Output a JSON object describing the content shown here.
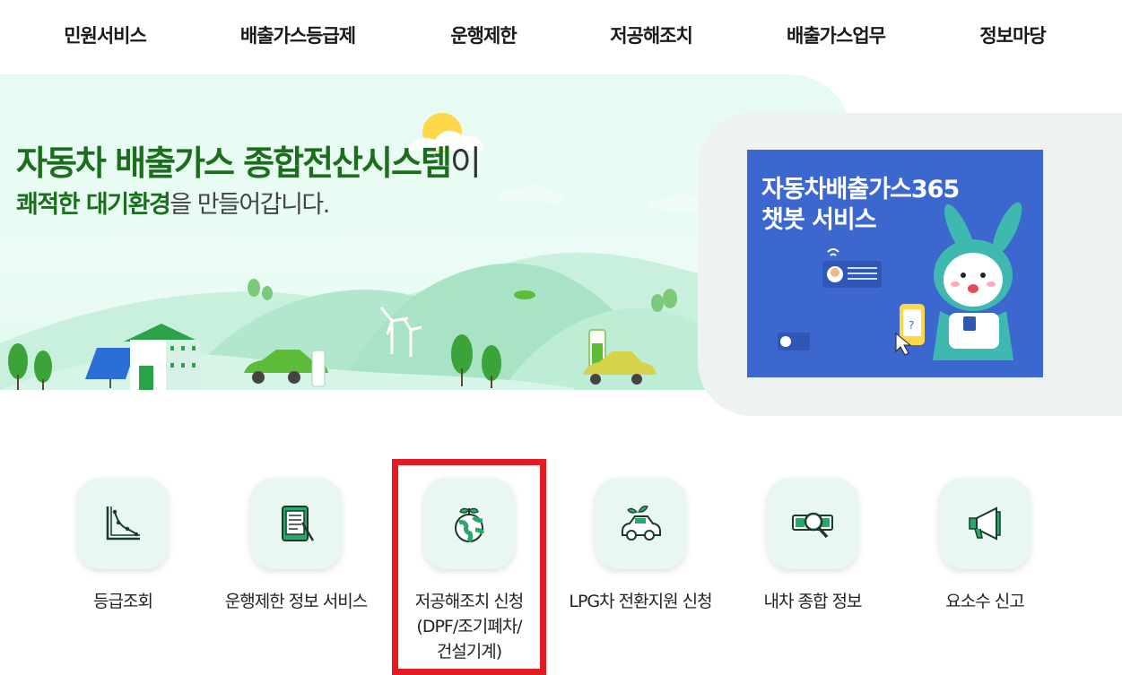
{
  "nav": {
    "items": [
      {
        "label": "민원서비스"
      },
      {
        "label": "배출가스등급제"
      },
      {
        "label": "운행제한"
      },
      {
        "label": "저공해조치"
      },
      {
        "label": "배출가스업무"
      },
      {
        "label": "정보마당"
      }
    ]
  },
  "hero": {
    "title_strong": "자동차 배출가스 종합전산시스템",
    "title_rest": "이",
    "sub_a": "쾌적한 ",
    "sub_c": "대기환경",
    "sub_b": "을 만들어갑니다."
  },
  "chatbot": {
    "line1": "자동차배출가스365",
    "line2": "챗봇 서비스"
  },
  "quick_menu": [
    {
      "label": "등급조회",
      "icon": "graph-chart-icon"
    },
    {
      "label": "운행제한 정보 서비스",
      "icon": "tablet-document-icon"
    },
    {
      "label": "저공해조치 신청\n(DPF/조기폐차/\n건설기계)",
      "icon": "earth-sprout-icon"
    },
    {
      "label": "LPG차 전환지원 신청",
      "icon": "eco-car-icon"
    },
    {
      "label": "내차 종합 정보",
      "icon": "magnifier-car-icon"
    },
    {
      "label": "요소수 신고",
      "icon": "megaphone-icon"
    }
  ],
  "colors": {
    "brand_green": "#1c6e1e",
    "hero_bg": "#e6fbf3",
    "chat_blue": "#3c67cf",
    "tile_bg": "#e8f7f1",
    "highlight_red": "#e31b23"
  }
}
